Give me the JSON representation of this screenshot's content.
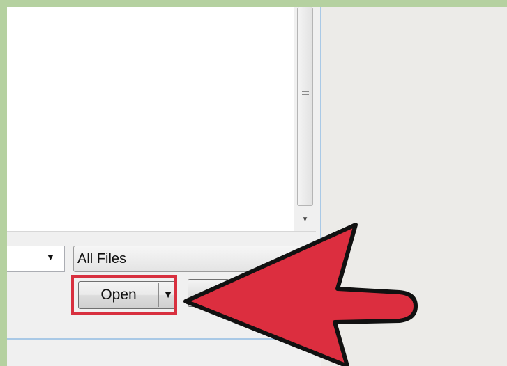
{
  "dialog": {
    "file_type_filter": {
      "value": "All Files"
    },
    "buttons": {
      "open_label": "Open",
      "open_split_icon": "triangle-down",
      "cancel_label": ""
    },
    "scrollbar": {
      "down_icon": "triangle-down-small"
    }
  },
  "annotation": {
    "arrow_color": "#dc2e3f",
    "highlight_color": "#d8303f",
    "arrow_icon": "pointing-arrow"
  }
}
